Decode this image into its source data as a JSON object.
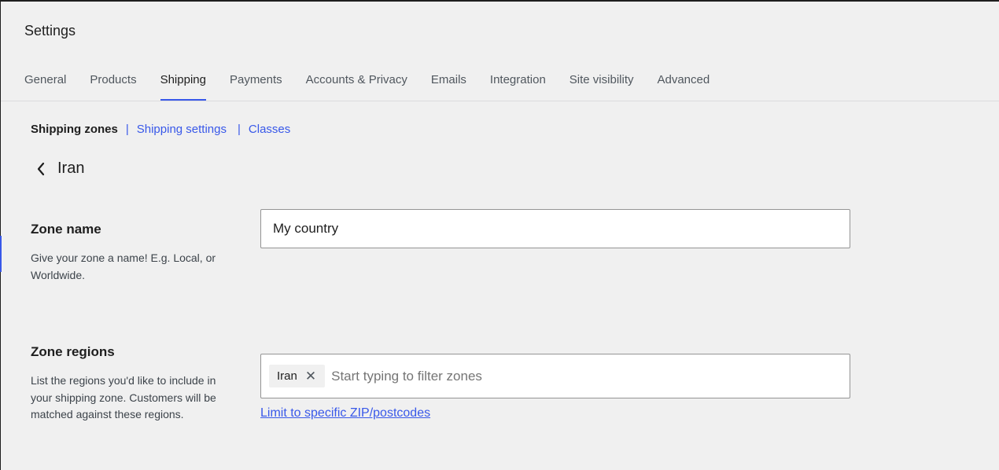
{
  "header": {
    "title": "Settings"
  },
  "tabs": [
    {
      "label": "General",
      "active": false
    },
    {
      "label": "Products",
      "active": false
    },
    {
      "label": "Shipping",
      "active": true
    },
    {
      "label": "Payments",
      "active": false
    },
    {
      "label": "Accounts & Privacy",
      "active": false
    },
    {
      "label": "Emails",
      "active": false
    },
    {
      "label": "Integration",
      "active": false
    },
    {
      "label": "Site visibility",
      "active": false
    },
    {
      "label": "Advanced",
      "active": false
    }
  ],
  "subnav": {
    "current": "Shipping zones",
    "separator": "|",
    "links": [
      "Shipping settings",
      "Classes"
    ]
  },
  "zone": {
    "title": "Iran",
    "back_icon": "chevron-left-icon"
  },
  "zone_name": {
    "label": "Zone name",
    "description": "Give your zone a name! E.g. Local, or Worldwide.",
    "value": "My country"
  },
  "zone_regions": {
    "label": "Zone regions",
    "description": "List the regions you'd like to include in your shipping zone. Customers will be matched against these regions.",
    "chips": [
      {
        "label": "Iran",
        "remove_icon": "close-icon",
        "remove_glyph": "✕"
      }
    ],
    "placeholder": "Start typing to filter zones",
    "postcode_link": "Limit to specific ZIP/postcodes"
  },
  "colors": {
    "accent": "#3858e9",
    "background": "#f0f0f0",
    "text": "#1e1e1e"
  }
}
